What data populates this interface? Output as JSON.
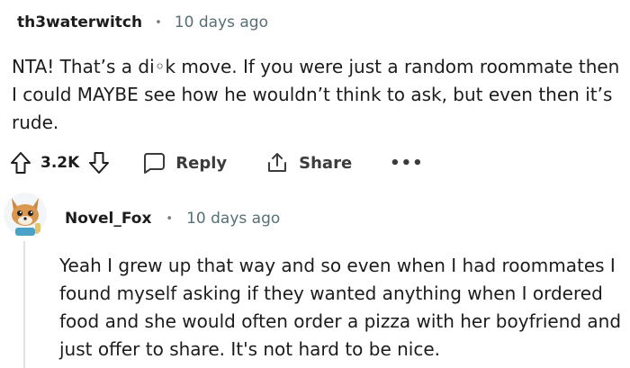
{
  "comment": {
    "username": "th3waterwitch",
    "separator": "•",
    "timestamp": "10 days ago",
    "body": "NTA! That’s a di◦k move. If you were just a random roommate then I could MAYBE see how he wouldn’t think to ask, but even then it’s rude.",
    "votes": "3.2K",
    "reply_label": "Reply",
    "share_label": "Share",
    "more_label": "•••",
    "icons": [
      "upvote-icon",
      "downvote-icon",
      "comment-bubble-icon",
      "share-icon"
    ]
  },
  "reply": {
    "username": "Novel_Fox",
    "separator": "•",
    "timestamp": "10 days ago",
    "body": "Yeah I grew up that way and so even when I had roommates I found myself asking if they wanted anything when I ordered food and she would often order a pizza with her boyfriend and just offer to share. It's not hard to be nice.",
    "avatar": "fox-avatar-icon"
  },
  "colors": {
    "text": "#1c1c1c",
    "meta": "#576f76",
    "thread_line": "#e2e2e2"
  }
}
